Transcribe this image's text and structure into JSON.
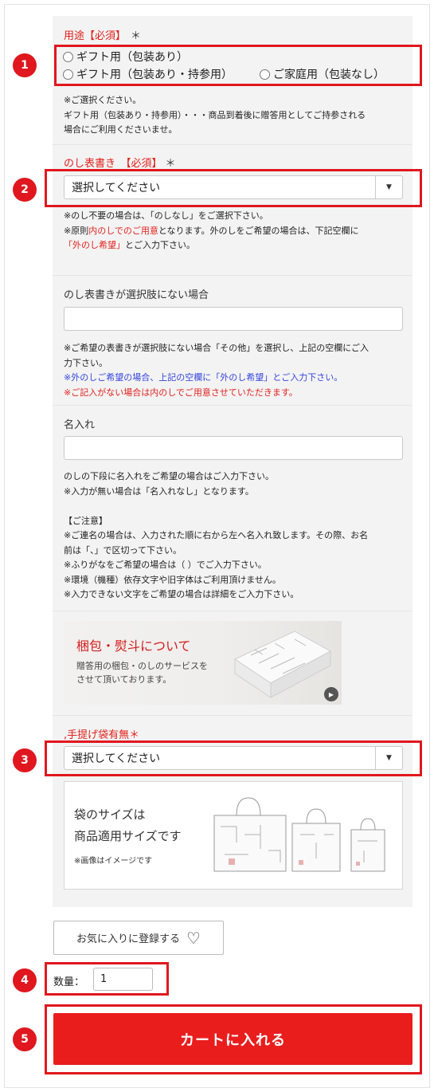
{
  "usage": {
    "label": "用途【必須】",
    "required_mark": "＊",
    "options": [
      "ギフト用（包装あり）",
      "ギフト用（包装あり・持参用）",
      "ご家庭用（包装なし）"
    ],
    "note_lines": [
      "※ご選択ください。",
      "ギフト用（包装あり・持参用）・・・商品到着後に贈答用としてご持参される",
      "場合にご利用くださいませ。"
    ]
  },
  "noshi": {
    "label": "のし表書き　【必須】",
    "required_mark": "＊",
    "selected": "選択してください",
    "note_line1": "※のし不要の場合は、「のしなし」をご選択下さい。",
    "note_line2_a": "※原則",
    "note_line2_red": "内のしでのご用意",
    "note_line2_b": "となります。外のしをご希望の場合は、下記空欄に",
    "note_line3_red": "「外のし希望」",
    "note_line3_b": "とご入力下さい。"
  },
  "noshi_custom": {
    "label": "のし表書きが選択肢にない場合",
    "value": "",
    "note_line1": "※ご希望の表書きが選択肢にない場合「その他」を選択し、上記の空欄にご入",
    "note_line2": "力下さい。",
    "note_line3_blue": "※外のしご希望の場合、上記の空欄に「外のし希望」とご入力下さい。",
    "note_line4_red": "※ご記入がない場合は内のしでご用意させていただきます。"
  },
  "name_print": {
    "label": "名入れ",
    "value": "",
    "note_lines": [
      "のしの下段に名入れをご希望の場合はご入力下さい。",
      "※入力が無い場合は「名入れなし」となります。",
      "",
      "【ご注意】",
      "※ご連名の場合は、入力された順に右から左へ名入れ致します。その際、お名",
      "前は「、」で区切って下さい。",
      "※ふりがなをご希望の場合は（ ）でご入力下さい。",
      "※環境（機種）依存文字や旧字体はご利用頂けません。",
      "※入力できない文字をご希望の場合は詳細をご入力下さい。"
    ]
  },
  "banner": {
    "title": "梱包・熨斗について",
    "subtitle_line1": "贈答用の梱包・のしのサービスを",
    "subtitle_line2": "させて頂いております。"
  },
  "bag": {
    "label": ",手提げ袋有無",
    "required_mark": "＊",
    "selected": "選択してください",
    "info_line1": "袋のサイズは",
    "info_line2": "商品適用サイズです",
    "info_note": "※画像はイメージです"
  },
  "favorite_button": "お気に入りに登録する",
  "quantity": {
    "label": "数量：",
    "value": "1"
  },
  "cart_button": "カートに入れる",
  "badges": [
    "1",
    "2",
    "3",
    "4",
    "5"
  ],
  "colors": {
    "accent_red": "#e0171e",
    "cart_red": "#ea1d1d",
    "note_blue": "#3344dd"
  },
  "icons": {
    "select_arrow": "chevron-down-icon",
    "favorite": "heart-icon",
    "play": "play-icon"
  }
}
